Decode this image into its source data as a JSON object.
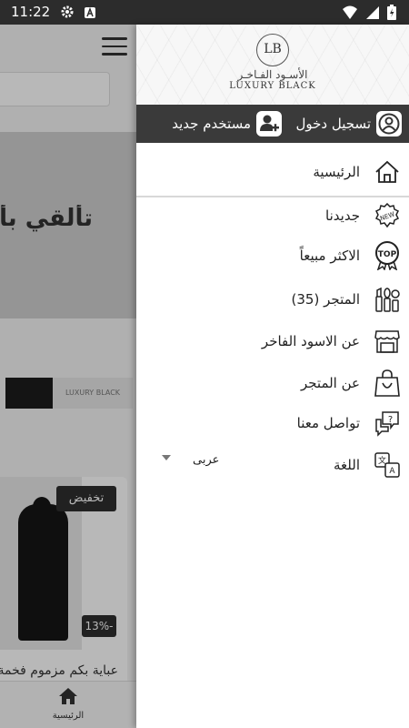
{
  "status_bar": {
    "time": "11:22"
  },
  "background": {
    "banner_text": "تألقي بأناقة",
    "sale_badge": "تخفيض",
    "discount_badge": "13%-",
    "product_title": "عباية بكم مزموم فخمة",
    "bottom_nav": {
      "home_label": "الرئيسية"
    },
    "strip_logo": "LUXURY BLACK"
  },
  "drawer": {
    "logo": {
      "monogram": "LB",
      "arabic": "الأسـود الفـاخـر",
      "english": "LUXURY BLACK"
    },
    "auth": {
      "login_label": "تسجيل دخول",
      "register_label": "مستخدم جديد"
    },
    "menu": [
      {
        "label": "الرئيسية",
        "icon": "home-icon"
      },
      {
        "label": "جديدنا",
        "icon": "new-badge-icon"
      },
      {
        "label": "الاكثر مبيعاً",
        "icon": "top-badge-icon"
      },
      {
        "label": "المتجر (35)",
        "icon": "cosmetics-icon"
      },
      {
        "label": "عن الاسود الفاخر",
        "icon": "storefront-icon"
      },
      {
        "label": "عن المتجر",
        "icon": "shopping-bag-icon"
      },
      {
        "label": "تواصل معنا",
        "icon": "chat-icon"
      },
      {
        "label": "اللغة",
        "icon": "translate-icon"
      }
    ],
    "language": {
      "selected": "عربى"
    }
  }
}
